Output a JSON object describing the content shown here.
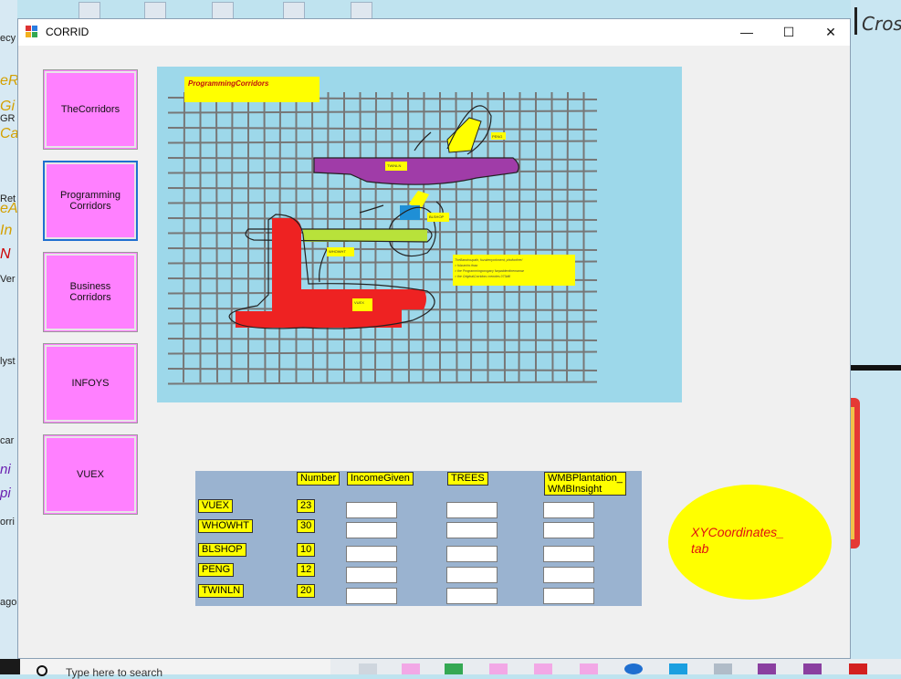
{
  "desktop": {
    "left_fragments": [
      "ecy",
      "eR",
      "Gi",
      "Ca",
      "GR",
      "Ret",
      "eA",
      "In",
      "N",
      "Ver",
      "lyst",
      "car",
      "ni",
      "pi",
      "orri",
      "ago"
    ],
    "right_text": "Cros"
  },
  "window": {
    "title": "CORRID",
    "controls": {
      "minimize": "—",
      "maximize": "☐",
      "close": "✕"
    }
  },
  "nav": [
    {
      "label": "TheCorridors",
      "active": false
    },
    {
      "label": "Programming\nCorridors",
      "active": true
    },
    {
      "label": "Business\nCorridors",
      "active": false
    },
    {
      "label": "INFOYS",
      "active": false
    },
    {
      "label": "VUEX",
      "active": false
    }
  ],
  "map": {
    "title": "ProgrammingCorridors",
    "labels": {
      "peng": "PENG",
      "twinln": "TWINLN",
      "blshop": "BLSHOP",
      "whowht": "WHOWHT",
      "vuex": "VUEX"
    },
    "note_lines": [
      "TheBandroupath, fuzukenyorkment, phofonfree/",
      " > fulzumho.fnaa",
      " > the Programmingocogacy fanpatdentinemamar",
      " > the OriginalCorridors crenotes 073dtli"
    ],
    "colors": {
      "purple": "#a03ca8",
      "yellow": "#ffff00",
      "red": "#ee2222",
      "lime": "#b8e23a",
      "blue": "#1f8fd6",
      "bg": "#9dd8ea"
    }
  },
  "table": {
    "headers": [
      "Number",
      "IncomeGiven",
      "TREES",
      "WMBPlantation_\nWMBInsight"
    ],
    "rows": [
      {
        "name": "VUEX",
        "number": "23"
      },
      {
        "name": "WHOWHT",
        "number": "30"
      },
      {
        "name": "BLSHOP",
        "number": "10"
      },
      {
        "name": "PENG",
        "number": "12"
      },
      {
        "name": "TWINLN",
        "number": "20"
      }
    ]
  },
  "ellipse_label": "XYCoordinates_\ntab",
  "taskbar": {
    "search_placeholder": "Type here to search"
  }
}
